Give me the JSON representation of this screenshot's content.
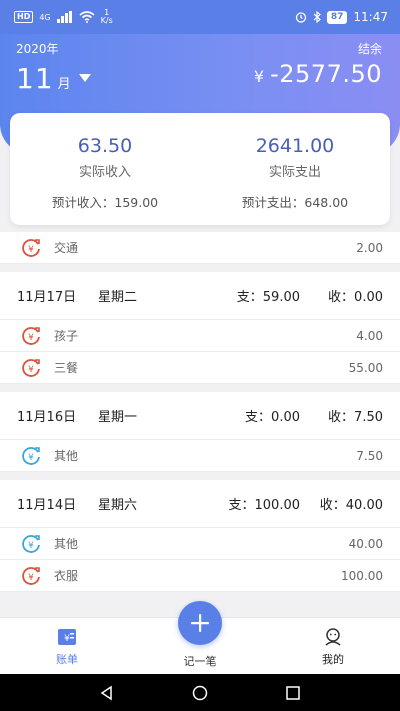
{
  "status_bar": {
    "hd": "HD",
    "net": "4G",
    "speed_value": "1",
    "speed_unit": "K/s",
    "battery": "87",
    "time": "11:47"
  },
  "header": {
    "year": "2020年",
    "balance_label": "结余",
    "month": "11",
    "month_unit": "月",
    "currency": "¥",
    "balance": "-2577.50"
  },
  "summary": {
    "actual_income": "63.50",
    "actual_income_label": "实际收入",
    "actual_expense": "2641.00",
    "actual_expense_label": "实际支出",
    "expected_income": "预计收入：159.00",
    "expected_expense": "预计支出：648.00"
  },
  "list": {
    "top_item": {
      "name": "交通",
      "amount": "2.00",
      "kind": "expense"
    },
    "days": [
      {
        "date": "11月17日",
        "weekday": "星期二",
        "expense": "支：59.00",
        "income": "收：0.00",
        "items": [
          {
            "name": "孩子",
            "amount": "4.00",
            "kind": "expense"
          },
          {
            "name": "三餐",
            "amount": "55.00",
            "kind": "expense"
          }
        ]
      },
      {
        "date": "11月16日",
        "weekday": "星期一",
        "expense": "支：0.00",
        "income": "收：7.50",
        "items": [
          {
            "name": "其他",
            "amount": "7.50",
            "kind": "income"
          }
        ]
      },
      {
        "date": "11月14日",
        "weekday": "星期六",
        "expense": "支：100.00",
        "income": "收：40.00",
        "items": [
          {
            "name": "其他",
            "amount": "40.00",
            "kind": "income"
          },
          {
            "name": "衣服",
            "amount": "100.00",
            "kind": "expense"
          }
        ]
      }
    ]
  },
  "nav": {
    "ledger": "账单",
    "add": "记一笔",
    "mine": "我的"
  },
  "colors": {
    "accent": "#5a7fe6",
    "expense_icon": "#d9533c",
    "income_icon": "#3aa6d6"
  }
}
